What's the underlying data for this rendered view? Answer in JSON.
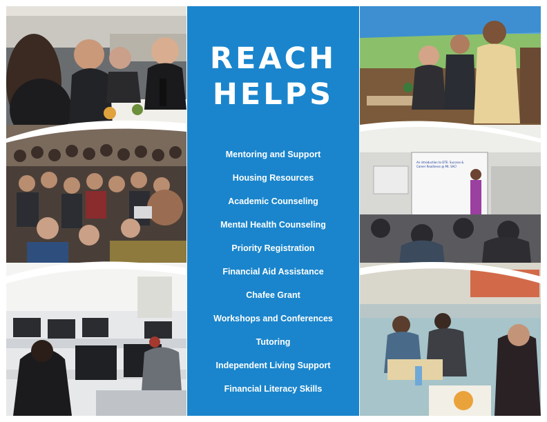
{
  "brand": {
    "panel_color": "#1a85cc",
    "text_color": "#ffffff",
    "title_line1": "REACH",
    "title_line2": "HELPS"
  },
  "services": [
    "Mentoring and Support",
    "Housing Resources",
    "Academic Counseling",
    "Mental Health Counseling",
    "Priority Registration",
    "Financial Aid Assistance",
    "Chafee Grant",
    "Workshops and Conferences",
    "Tutoring",
    "Independent Living Support",
    "Financial Literacy Skills"
  ],
  "slide": {
    "line1": "An introduction to DTE: Success &",
    "line2": "Career Readiness @ Mt. SAC!"
  }
}
